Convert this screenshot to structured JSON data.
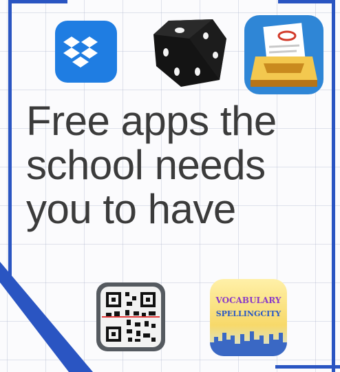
{
  "poster": {
    "headline_lines": [
      "Free apps the",
      "school needs",
      "you to have"
    ],
    "colors": {
      "frame": "#2a55c2",
      "headline_text": "#3b3b3b",
      "dropbox": "#1f7de2",
      "showbie_bg": "#2f86d6"
    }
  },
  "apps": [
    {
      "name": "dropbox",
      "icon": "dropbox-icon"
    },
    {
      "name": "dice",
      "icon": "dice-icon"
    },
    {
      "name": "showbie",
      "icon": "inbox-tray-icon"
    },
    {
      "name": "qr-reader",
      "icon": "qr-code-icon"
    },
    {
      "name": "vocabulary-spelling-city",
      "icon": "vocabulary-spellingcity-icon",
      "logo_text": [
        "VOCABULARY",
        "SPELLINGCITY"
      ]
    }
  ]
}
